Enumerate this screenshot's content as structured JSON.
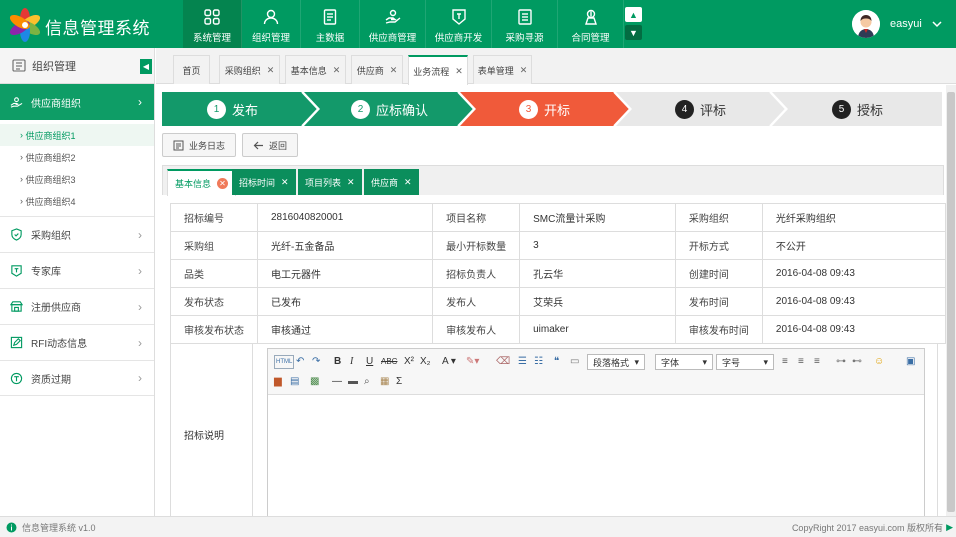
{
  "header": {
    "title": "信息管理系统",
    "nav": [
      {
        "label": "系统管理",
        "icon": "grid-icon"
      },
      {
        "label": "组织管理",
        "icon": "user-icon"
      },
      {
        "label": "主数据",
        "icon": "document-icon"
      },
      {
        "label": "供应商管理",
        "icon": "hand-icon"
      },
      {
        "label": "供应商开发",
        "icon": "badge-icon"
      },
      {
        "label": "采购寻源",
        "icon": "list-icon"
      },
      {
        "label": "合同管理",
        "icon": "contract-icon"
      }
    ],
    "user": {
      "name": "easyui"
    }
  },
  "sidebar": {
    "title": "组织管理",
    "active_menu": "供应商组织",
    "sub_items": [
      "供应商组织1",
      "供应商组织2",
      "供应商组织3",
      "供应商组织4"
    ],
    "menus": [
      "采购组织",
      "专家库",
      "注册供应商",
      "RFI动态信息",
      "资质过期"
    ]
  },
  "tabs": [
    {
      "label": "首页",
      "closable": false
    },
    {
      "label": "采购组织",
      "closable": true
    },
    {
      "label": "基本信息",
      "closable": true
    },
    {
      "label": "供应商",
      "closable": true
    },
    {
      "label": "业务流程",
      "closable": true,
      "active": true
    },
    {
      "label": "表单管理",
      "closable": true
    }
  ],
  "steps": [
    {
      "num": "1",
      "label": "发布",
      "state": "done"
    },
    {
      "num": "2",
      "label": "应标确认",
      "state": "done"
    },
    {
      "num": "3",
      "label": "开标",
      "state": "current"
    },
    {
      "num": "4",
      "label": "评标",
      "state": "todo"
    },
    {
      "num": "5",
      "label": "授标",
      "state": "todo"
    }
  ],
  "buttons": {
    "log": "业务日志",
    "back": "返回"
  },
  "inner_tabs": [
    "基本信息",
    "招标时间",
    "项目列表",
    "供应商"
  ],
  "info_rows": [
    [
      "招标编号",
      "2816040820001",
      "项目名称",
      "SMC流量计采购",
      "采购组织",
      "光纤采购组织"
    ],
    [
      "采购组",
      "光纤-五金备品",
      "最小开标数量",
      "3",
      "开标方式",
      "不公开"
    ],
    [
      "品类",
      "电工元器件",
      "招标负责人",
      "孔云华",
      "创建时间",
      "2016-04-08 09:43"
    ],
    [
      "发布状态",
      "已发布",
      "发布人",
      "艾荣兵",
      "发布时间",
      "2016-04-08 09:43"
    ],
    [
      "审核发布状态",
      "审核通过",
      "审核发布人",
      "uimaker",
      "审核发布时间",
      "2016-04-08 09:43"
    ]
  ],
  "description_label": "招标说明",
  "editor": {
    "paragraph_format": "段落格式",
    "font": "字体",
    "font_size": "字号"
  },
  "footer": {
    "version": "信息管理系统 v1.0",
    "copyright": "CopyRight 2017  easyui.com 版权所有"
  },
  "colors": {
    "primary": "#009a61",
    "current_step": "#f05a3a",
    "todo_step": "#e8e8e8"
  }
}
